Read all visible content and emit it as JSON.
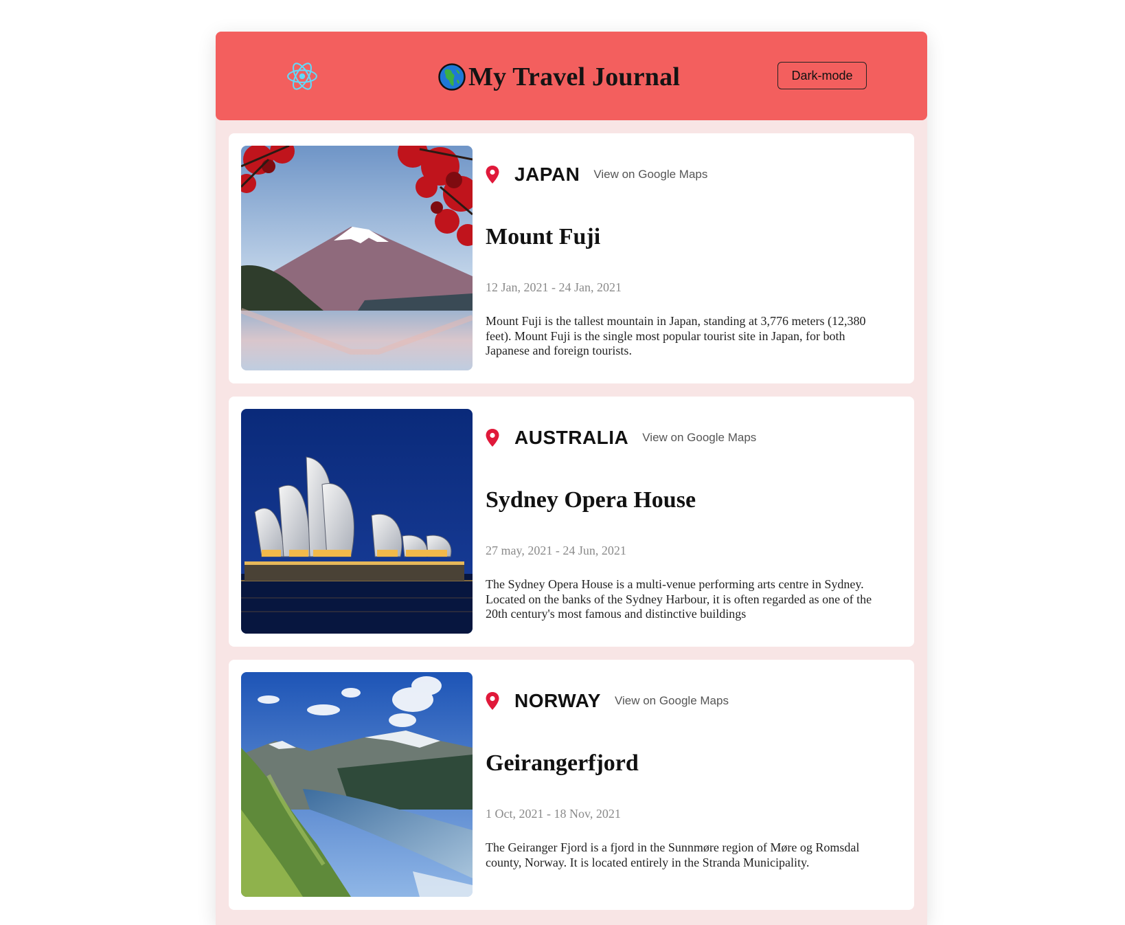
{
  "header": {
    "title": "My Travel Journal",
    "dark_mode_label": "Dark-mode",
    "logo_icon": "react-atom-icon",
    "globe_icon": "globe-icon"
  },
  "colors": {
    "header_bg": "#f35f5e",
    "page_bg": "#f8e5e5",
    "card_bg": "#ffffff",
    "pin": "#e0193a"
  },
  "entries": [
    {
      "country": "JAPAN",
      "maps_label": "View on Google Maps",
      "title": "Mount Fuji",
      "dates": "12 Jan, 2021 - 24 Jan, 2021",
      "description": "Mount Fuji is the tallest mountain in Japan, standing at 3,776 meters (12,380 feet). Mount Fuji is the single most popular tourist site in Japan, for both Japanese and foreign tourists.",
      "image": "mount-fuji-photo"
    },
    {
      "country": "AUSTRALIA",
      "maps_label": "View on Google Maps",
      "title": "Sydney Opera House",
      "dates": "27 may, 2021 - 24 Jun, 2021",
      "description": "The Sydney Opera House is a multi-venue performing arts centre in Sydney. Located on the banks of the Sydney Harbour, it is often regarded as one of the 20th century's most famous and distinctive buildings",
      "image": "sydney-opera-house-photo"
    },
    {
      "country": "NORWAY",
      "maps_label": "View on Google Maps",
      "title": "Geirangerfjord",
      "dates": "1 Oct, 2021 - 18 Nov, 2021",
      "description": "The Geiranger Fjord is a fjord in the Sunnmøre region of Møre og Romsdal county, Norway. It is located entirely in the Stranda Municipality.",
      "image": "geirangerfjord-photo"
    }
  ]
}
